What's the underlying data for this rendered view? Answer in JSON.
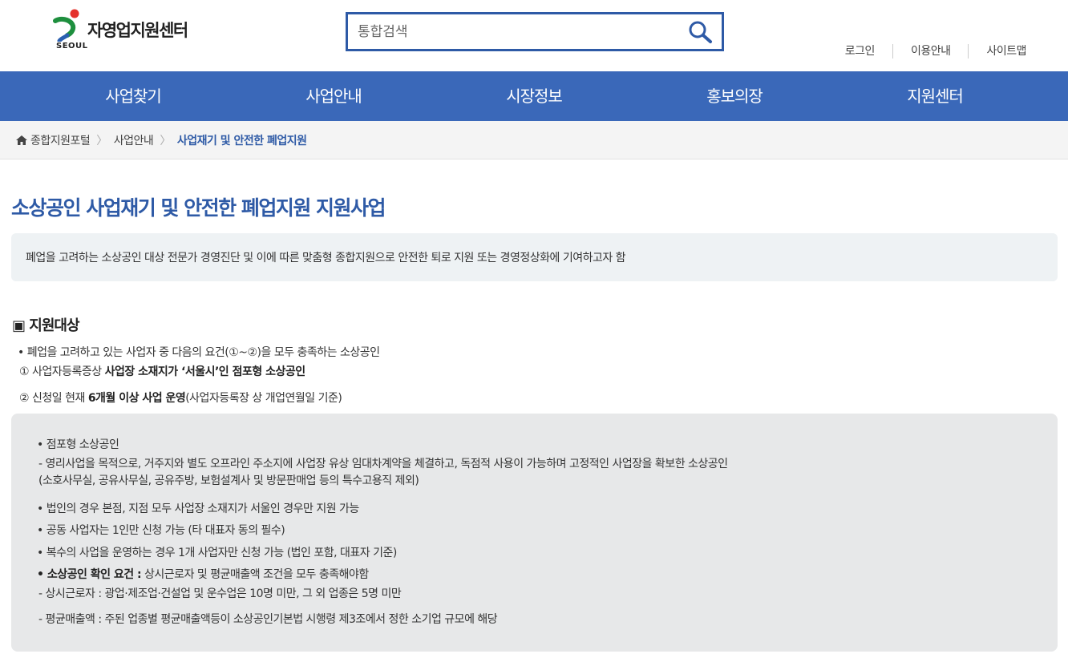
{
  "header": {
    "logo_text": "자영업지원센터",
    "logo_sub": "SEOUL",
    "search_placeholder": "통합검색",
    "util_links": [
      "로그인",
      "이용안내",
      "사이트맵"
    ]
  },
  "nav": {
    "items": [
      "사업찾기",
      "사업안내",
      "시장정보",
      "홍보의장",
      "지원센터"
    ]
  },
  "breadcrumb": {
    "items": [
      "종합지원포털",
      "사업안내",
      "사업재기 및 안전한 폐업지원"
    ]
  },
  "page": {
    "title": "소상공인 사업재기 및 안전한 폐업지원 지원사업",
    "summary": "폐업을 고려하는 소상공인 대상 전문가 경영진단 및 이에 따른 맞춤형 종합지원으로 안전한 퇴로 지원 또는 경영정상화에 기여하고자 함"
  },
  "target": {
    "title": "▣ 지원대상",
    "intro": "• 폐업을 고려하고 있는 사업자 중 다음의 요건(①~②)을 모두 충족하는 소상공인",
    "req1_prefix": "① 사업자등록증상 ",
    "req1_bold": "사업장 소재지가 ‘서울시’인 점포형 소상공인",
    "req2_prefix": "② 신청일 현재 ",
    "req2_bold": "6개월 이상 사업 운영",
    "req2_suffix": "(사업자등록장 상 개업연월일 기준)"
  },
  "notes": {
    "n1_title": "• 점포형 소상공인",
    "n1_desc1": "- 영리사업을 목적으로, 거주지와 별도 오프라인 주소지에 사업장 유상 임대차계약을 체결하고, 독점적 사용이 가능하며 고정적인 사업장을 확보한 소상공인",
    "n1_desc2": "(소호사무실, 공유사무실, 공유주방, 보험설계사 및 방문판매업 등의 특수고용직 제외)",
    "n2": "• 법인의 경우 본점, 지점 모두 사업장 소재지가 서울인 경우만 지원 가능",
    "n3": "• 공동 사업자는 1인만 신청 가능 (타 대표자 동의 필수)",
    "n4": "• 복수의 사업을 운영하는 경우 1개 사업자만 신청 가능 (법인 포함, 대표자 기준)",
    "n5_bold": "• 소상공인 확인 요건 :",
    "n5_rest": " 상시근로자 및 평균매출액 조건을 모두 충족해야함",
    "n5_d1": "- 상시근로자 : 광업·제조업·건설업 및 운수업은 10명 미만, 그 외 업종은 5명 미만",
    "n5_d2": "- 평균매출액 : 주된 업종별 평균매출액등이 소상공인기본법 시행령 제3조에서 정한 소기업 규모에 해당"
  },
  "colors": {
    "brand_blue": "#3a68b9",
    "title_blue": "#2e5aa6"
  }
}
